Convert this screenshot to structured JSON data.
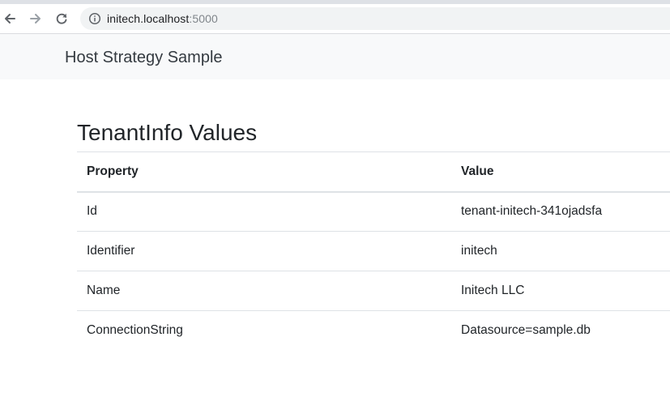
{
  "browser": {
    "url_host": "initech.localhost",
    "url_port": ":5000",
    "icons": [
      "back-arrow-icon",
      "forward-arrow-icon",
      "reload-icon",
      "info-icon"
    ],
    "colors": {
      "tab_strip": "#dee1e6",
      "omnibox": "#f1f3f4",
      "icon": "#5f6368",
      "icon_disabled": "#9aa0a6"
    }
  },
  "navbar": {
    "brand": "Host Strategy Sample"
  },
  "main": {
    "title": "TenantInfo Values",
    "table": {
      "headers": [
        "Property",
        "Value"
      ],
      "rows": [
        [
          "Id",
          "tenant-initech-341ojadsfa"
        ],
        [
          "Identifier",
          "initech"
        ],
        [
          "Name",
          "Initech LLC"
        ],
        [
          "ConnectionString",
          "Datasource=sample.db"
        ]
      ]
    }
  }
}
